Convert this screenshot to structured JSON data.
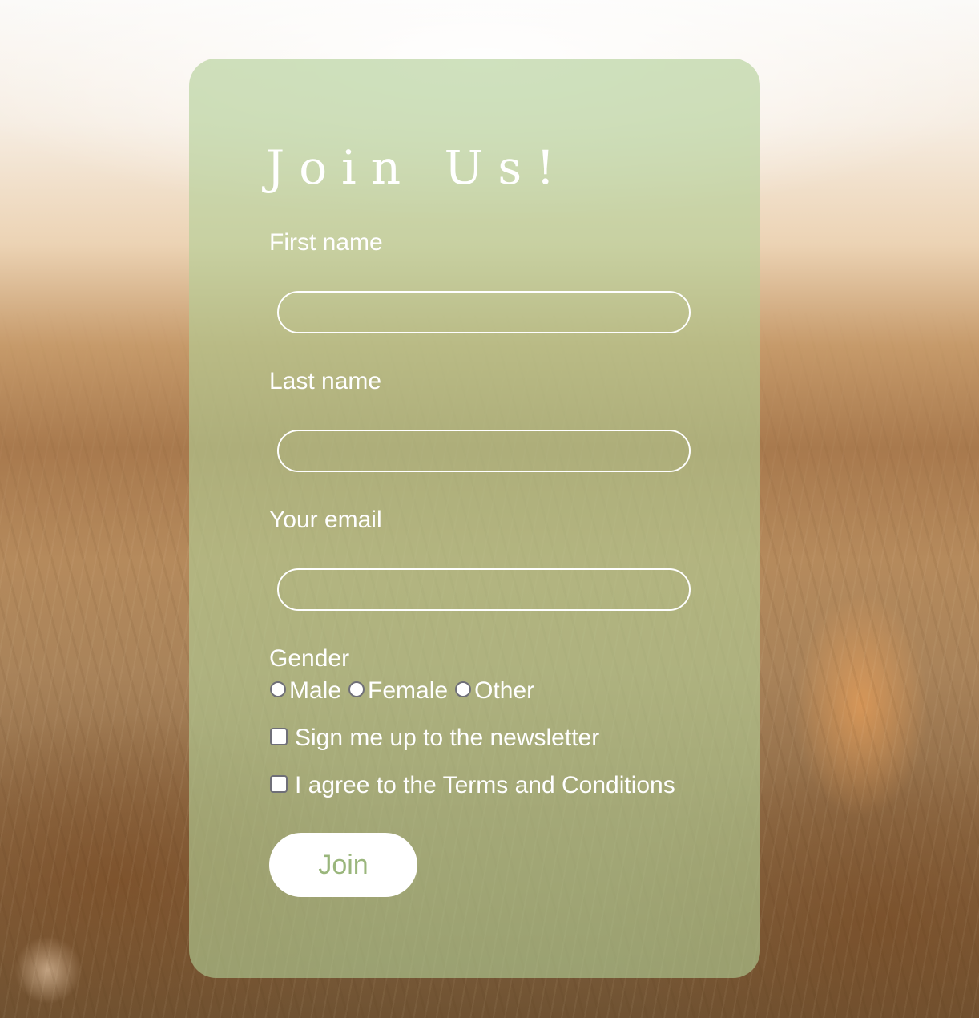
{
  "form": {
    "title": "Join Us!",
    "fields": {
      "first_name": {
        "label": "First name",
        "value": "",
        "placeholder": ""
      },
      "last_name": {
        "label": "Last name",
        "value": "",
        "placeholder": ""
      },
      "email": {
        "label": "Your email",
        "value": "",
        "placeholder": ""
      }
    },
    "gender": {
      "label": "Gender",
      "options": [
        "Male",
        "Female",
        "Other"
      ],
      "selected": null
    },
    "newsletter": {
      "label": "Sign me up to the newsletter",
      "checked": false
    },
    "terms": {
      "label": "I agree to the Terms and Conditions",
      "checked": false
    },
    "submit_label": "Join"
  },
  "colors": {
    "card_tint": "#b2ce96",
    "text": "#ffffff",
    "button_bg": "#ffffff",
    "button_text": "#9ab67c"
  }
}
